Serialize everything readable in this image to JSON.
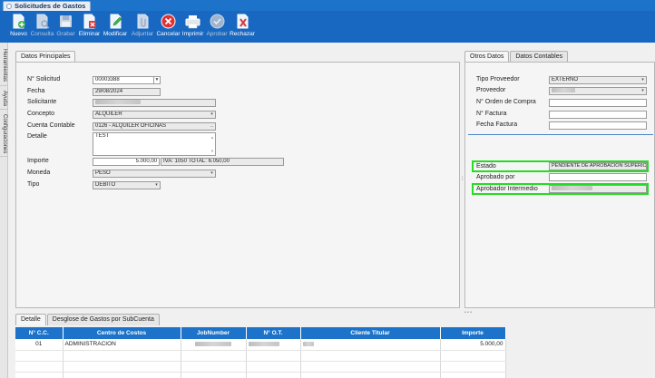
{
  "window": {
    "tab_title": "Solicitudes de Gastos"
  },
  "toolbar": [
    {
      "name": "nuevo",
      "label": "Nuevo",
      "enabled": true,
      "icon": "document-add-icon"
    },
    {
      "name": "consulta",
      "label": "Consulta",
      "enabled": false,
      "icon": "document-search-icon"
    },
    {
      "name": "grabar",
      "label": "Grabar",
      "enabled": false,
      "icon": "save-icon"
    },
    {
      "name": "eliminar",
      "label": "Eliminar",
      "enabled": true,
      "icon": "document-delete-icon"
    },
    {
      "name": "modificar",
      "label": "Modificar",
      "enabled": true,
      "icon": "document-edit-icon"
    },
    {
      "name": "adjuntar",
      "label": "Adjuntar",
      "enabled": false,
      "icon": "attach-icon"
    },
    {
      "name": "cancelar",
      "label": "Cancelar",
      "enabled": true,
      "icon": "cancel-icon"
    },
    {
      "name": "imprimir",
      "label": "Imprimir",
      "enabled": true,
      "icon": "printer-icon"
    },
    {
      "name": "aprobar",
      "label": "Aprobar",
      "enabled": false,
      "icon": "approve-icon"
    },
    {
      "name": "rechazar",
      "label": "Rechazar",
      "enabled": true,
      "icon": "reject-icon"
    }
  ],
  "side_tabs": [
    "Herramientas",
    "Ayuda",
    "Configuraciones"
  ],
  "main": {
    "tab": "Datos Principales",
    "labels": {
      "solicitud": "N° Solicitud",
      "fecha": "Fecha",
      "solicitante": "Solicitante",
      "concepto": "Concepto",
      "cuenta": "Cuenta Contable",
      "detalle": "Detalle",
      "importe": "Importe",
      "moneda": "Moneda",
      "tipo": "Tipo"
    },
    "values": {
      "solicitud": "00003388",
      "fecha": "29/08/2024",
      "concepto": "ALQUILER",
      "cuenta": "0126 - ALQUILER OFICINAS",
      "cuenta_btn": "...",
      "detalle": "TEST",
      "importe": "5.000,00",
      "iva": "IVA: 1050 TOTAL:  6.050,00",
      "moneda": "PESO",
      "tipo": "DEBITO"
    }
  },
  "other": {
    "tabs": [
      "Otros Datos",
      "Datos Contables"
    ],
    "labels": {
      "tipo_proveedor": "Tipo Proveedor",
      "proveedor": "Proveedor",
      "orden_compra": "N° Orden de Compra",
      "factura": "N° Factura",
      "fecha_factura": "Fecha Factura",
      "estado": "Estado",
      "aprobado_por": "Aprobado por",
      "aprobador_intermedio": "Aprobador Intermedio"
    },
    "values": {
      "tipo_proveedor": "EXTERNO",
      "estado": "PENDIENTE DE APROBACIÓN SUPERIOR"
    }
  },
  "detail": {
    "tabs": [
      "Detalle",
      "Desglose de Gastos por SubCuenta"
    ],
    "columns": [
      "N° C.C.",
      "Centro de Costos",
      "JobNumber",
      "N° O.T.",
      "Cliente Titular",
      "Importe"
    ],
    "rows": [
      {
        "cc": "01",
        "centro": "ADMINISTRACION",
        "importe": "5.000,00"
      }
    ]
  }
}
